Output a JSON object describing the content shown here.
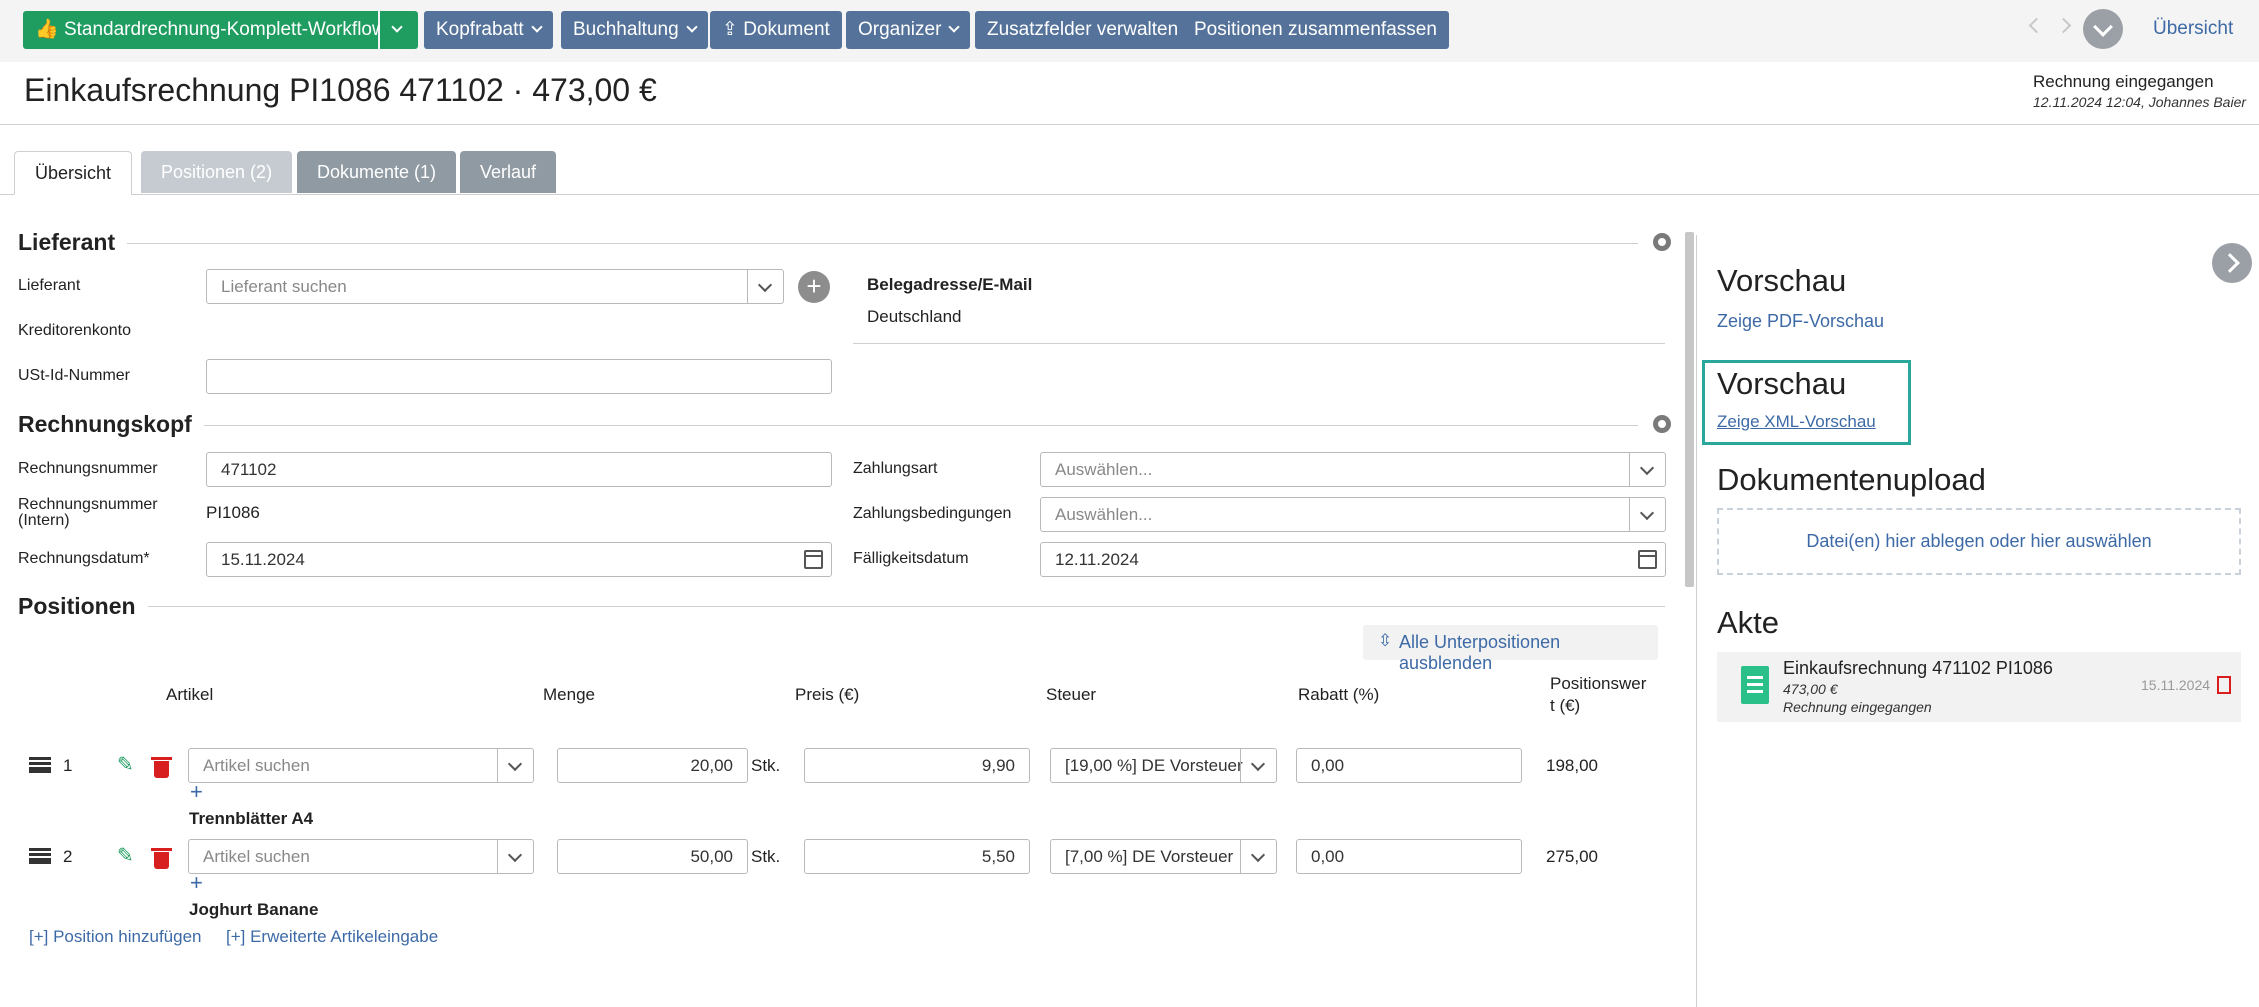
{
  "toolbar": {
    "workflow_label": "Standardrechnung-Komplett-Workflow",
    "buttons": [
      "Kopfrabatt",
      "Buchhaltung",
      "Dokument",
      "Organizer",
      "Zusatzfelder verwalten",
      "Positionen zusammenfassen"
    ],
    "overview_link": "Übersicht",
    "colors": {
      "blue": "#55739a",
      "green": "#1f9d61"
    }
  },
  "header": {
    "title": "Einkaufsrechnung PI1086 471102 · 473,00 €",
    "status": "Rechnung eingegangen",
    "status_meta": "12.11.2024 12:04, Johannes Baier"
  },
  "tabs": [
    {
      "label": "Übersicht",
      "active": true
    },
    {
      "label": "Positionen (2)",
      "active": false
    },
    {
      "label": "Dokumente (1)",
      "active": false
    },
    {
      "label": "Verlauf",
      "active": false
    }
  ],
  "lieferant": {
    "section_title": "Lieferant",
    "lieferant_label": "Lieferant",
    "lieferant_placeholder": "Lieferant suchen",
    "kreditorenkonto_label": "Kreditorenkonto",
    "ustid_label": "USt-Id-Nummer",
    "ustid_value": "",
    "address_title": "Belegadresse/E-Mail",
    "address_country": "Deutschland"
  },
  "rechnungskopf": {
    "section_title": "Rechnungskopf",
    "nummer_label": "Rechnungsnummer",
    "nummer_value": "471102",
    "intern_label_1": "Rechnungsnummer",
    "intern_label_2": "(Intern)",
    "intern_value": "PI1086",
    "datum_label": "Rechnungsdatum*",
    "datum_value": "15.11.2024",
    "zahlungsart_label": "Zahlungsart",
    "zahlungsart_placeholder": "Auswählen...",
    "bedingungen_label": "Zahlungsbedingungen",
    "bedingungen_placeholder": "Auswählen...",
    "faellig_label": "Fälligkeitsdatum",
    "faellig_value": "12.11.2024"
  },
  "positionen": {
    "section_title": "Positionen",
    "collapse_label": "Alle Unterpositionen ausblenden",
    "columns": {
      "artikel": "Artikel",
      "menge": "Menge",
      "preis": "Preis (€)",
      "steuer": "Steuer",
      "rabatt": "Rabatt (%)",
      "wert_1": "Positionswer",
      "wert_2": "t (€)"
    },
    "article_placeholder": "Artikel suchen",
    "rows": [
      {
        "num": "1",
        "menge": "20,00",
        "unit": "Stk.",
        "preis": "9,90",
        "steuer": "[19,00 %] DE Vorsteuer",
        "rabatt": "0,00",
        "wert": "198,00",
        "name": "Trennblätter A4"
      },
      {
        "num": "2",
        "menge": "50,00",
        "unit": "Stk.",
        "preis": "5,50",
        "steuer": "[7,00 %] DE Vorsteuer",
        "rabatt": "0,00",
        "wert": "275,00",
        "name": "Joghurt Banane"
      }
    ],
    "add_position": "[+] Position hinzufügen",
    "extended_entry": "[+] Erweiterte Artikeleingabe"
  },
  "sidebar": {
    "preview_title": "Vorschau",
    "pdf_link": "Zeige PDF-Vorschau",
    "xml_title": "Vorschau",
    "xml_link": "Zeige XML-Vorschau",
    "upload_title": "Dokumentenupload",
    "upload_drop": "Datei(en) hier ablegen oder hier auswählen",
    "akte_title": "Akte",
    "akte_doc_title": "Einkaufsrechnung 471102 PI1086",
    "akte_doc_amount": "473,00 €",
    "akte_doc_status": "Rechnung eingegangen",
    "akte_doc_date": "15.11.2024"
  }
}
